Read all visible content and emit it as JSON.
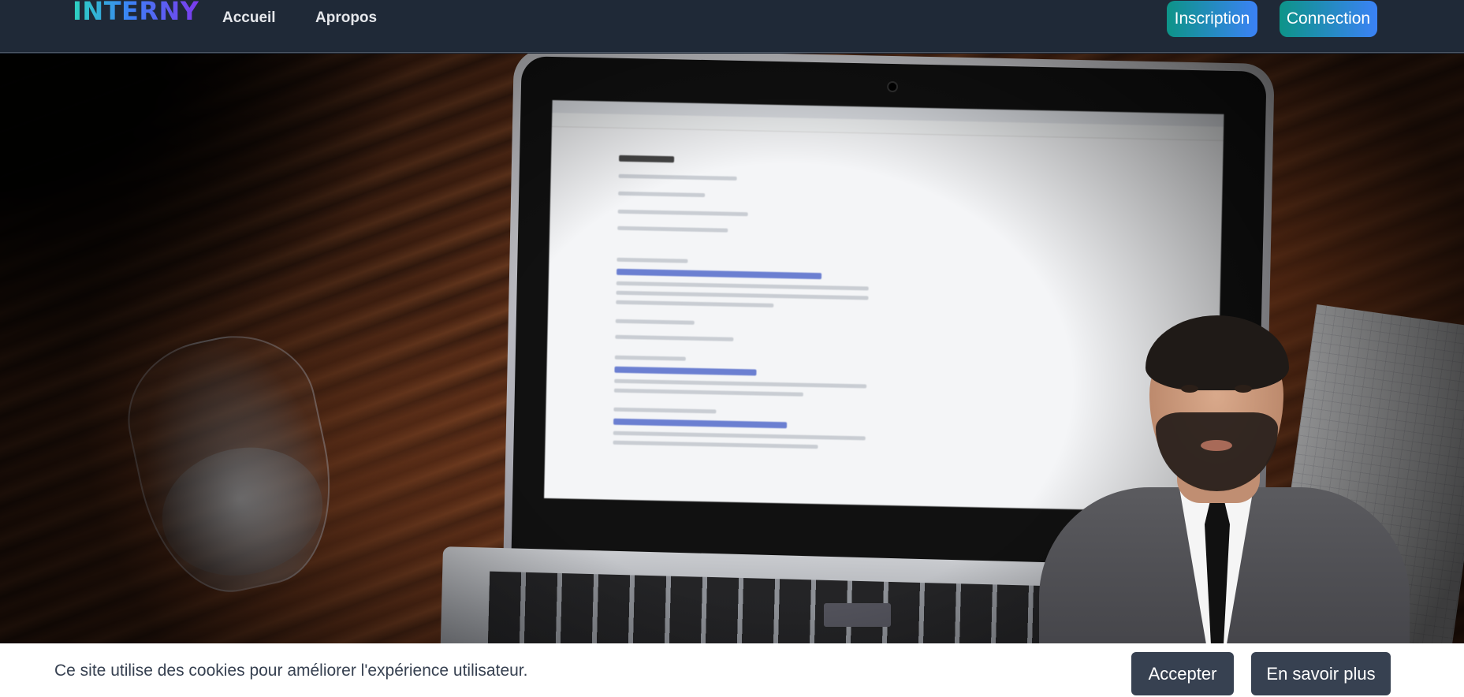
{
  "navbar": {
    "logo": "INTERNY",
    "links": [
      {
        "label": "Accueil"
      },
      {
        "label": "Apropos"
      }
    ],
    "buttons": {
      "signup": "Inscription",
      "login": "Connection"
    },
    "colors": {
      "background": "#1f2937",
      "button_gradient_start": "#0d9488",
      "button_gradient_end": "#3b82f6"
    }
  },
  "hero": {
    "type": "video",
    "description_icon": "presenter-video"
  },
  "cookie_banner": {
    "message": "Ce site utilise des cookies pour améliorer l'expérience utilisateur.",
    "accept_label": "Accepter",
    "more_label": "En savoir plus",
    "colors": {
      "background": "#ffffff",
      "button": "#374151"
    }
  }
}
